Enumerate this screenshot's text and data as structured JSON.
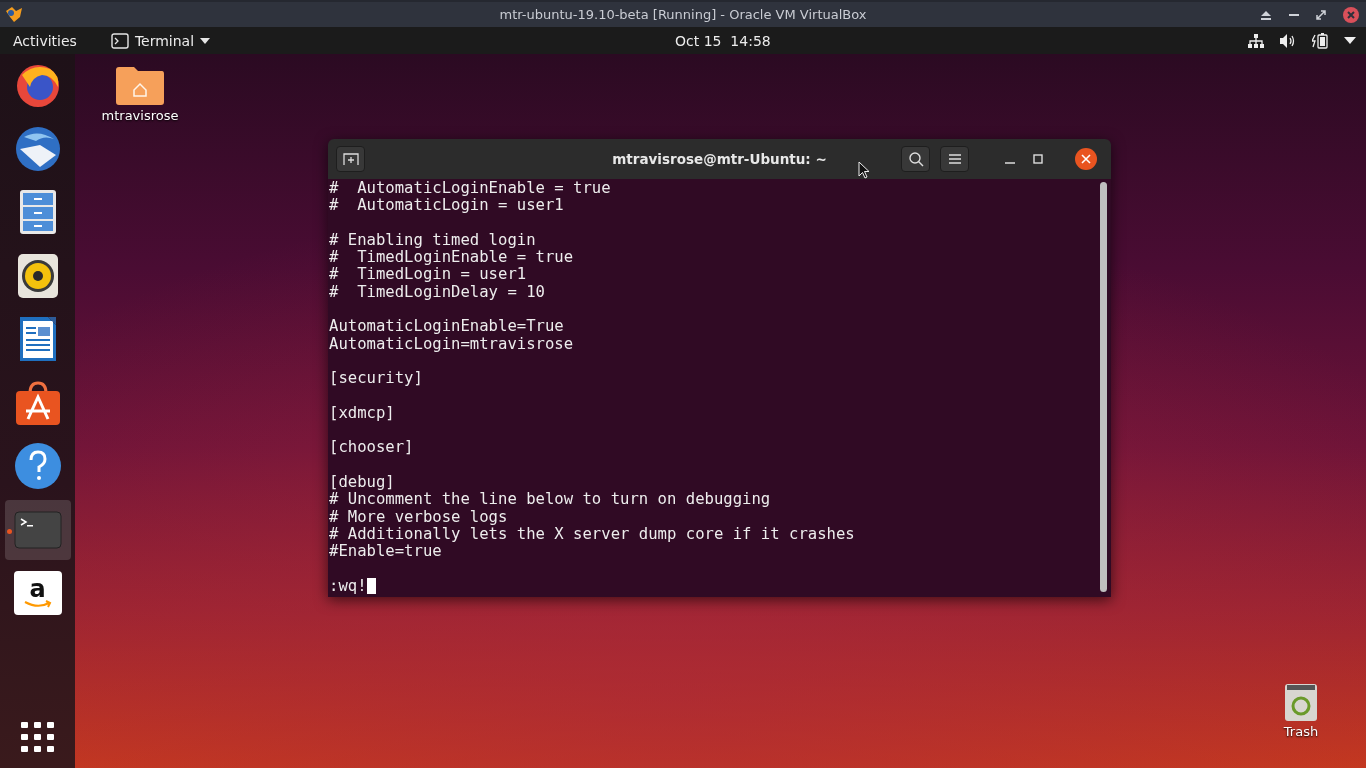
{
  "host_window": {
    "title": "mtr-ubuntu-19.10-beta [Running] - Oracle VM VirtualBox"
  },
  "top_bar": {
    "activities": "Activities",
    "app_menu": "Terminal",
    "clock": "Oct 15  14:58"
  },
  "dock": {
    "items": [
      {
        "kind": "browser",
        "running": false,
        "selected": false
      },
      {
        "kind": "mail",
        "running": false,
        "selected": false
      },
      {
        "kind": "files",
        "running": false,
        "selected": false
      },
      {
        "kind": "music",
        "running": false,
        "selected": false
      },
      {
        "kind": "writer",
        "running": false,
        "selected": false
      },
      {
        "kind": "store",
        "running": false,
        "selected": false
      },
      {
        "kind": "help",
        "running": false,
        "selected": false
      },
      {
        "kind": "terminal",
        "running": true,
        "selected": true
      },
      {
        "kind": "amazon",
        "label": "a",
        "running": false,
        "selected": false
      }
    ]
  },
  "desktop": {
    "home_folder": {
      "label": "mtravisrose"
    },
    "trash": {
      "label": "Trash"
    }
  },
  "terminal": {
    "title": "mtravisrose@mtr-Ubuntu: ~",
    "blocks": [
      [
        "#  AutomaticLoginEnable = true",
        "#  AutomaticLogin = user1"
      ],
      [
        "# Enabling timed login",
        "#  TimedLoginEnable = true",
        "#  TimedLogin = user1",
        "#  TimedLoginDelay = 10"
      ],
      [
        "AutomaticLoginEnable=True",
        "AutomaticLogin=mtravisrose"
      ],
      [
        "[security]"
      ],
      [
        "[xdmcp]"
      ],
      [
        "[chooser]"
      ],
      [
        "[debug]",
        "# Uncomment the line below to turn on debugging",
        "# More verbose logs",
        "# Additionally lets the X server dump core if it crashes",
        "#Enable=true"
      ]
    ],
    "command": ":wq!"
  }
}
